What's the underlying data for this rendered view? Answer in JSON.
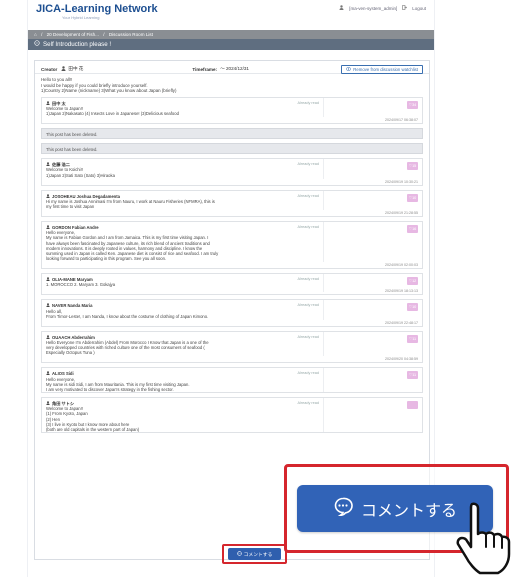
{
  "header": {
    "logo": "JICA-Learning Network",
    "logo_sub": "Your Hybrid Learning",
    "user": "[ma-ven-system_admin]",
    "logout": "Logout"
  },
  "breadcrumb": {
    "home": "⌂",
    "course": "20 Development of Fish...",
    "page": "Discussion Room List"
  },
  "title": "Self Introduction please !",
  "creator": {
    "label": "Creator",
    "name": "田中 花",
    "timeframe_label": "Timeframe:",
    "timeframe_value": "～ 2024/12/31",
    "remove_button": "Remove from discussion watchlist"
  },
  "intro": [
    "Hello to you all!!",
    "I would be happy if you could briefly introduce yourself.",
    "1)Country  2)Name (nickname)  3)What you know about Japan (briefly)"
  ],
  "posts": [
    {
      "author": "田中 太",
      "status": "Already read",
      "like": "♡34",
      "body": [
        "Welcome to Japan!!",
        "1)Japan   2)Nakasato  (4) Insects Love in Japanese! (3)Delicious seafood"
      ],
      "time": "2024/09/17 06:38:07"
    },
    {
      "deleted": "This post has been deleted."
    },
    {
      "deleted": "This post has been deleted."
    },
    {
      "author": "佐藤 浩二",
      "status": "Already read",
      "like": "♡15",
      "body": [
        "Welcome to Koichi!!",
        "1)Japan 2)Sati Sato (Sato) 3)Hiraoka"
      ],
      "time": "2024/09/19 10:30:21"
    },
    {
      "author": "JOSOHEAU Joshua Degadamenta",
      "status": "Already read",
      "like": "♡10",
      "body": [
        "Hi my name is Joshua Annimasi I'm from Nauru, I work at Nauru Fisheries (NFMRA), this is",
        "my first time to visit Japan"
      ],
      "time": "2024/09/19 21:28:55"
    },
    {
      "author": "GORDON Fabian Andre",
      "status": "Already read",
      "like": "♡16",
      "body": [
        "Hello everyone,",
        "My name is Fabian Gordon and I am from Jamaica. This is my first time visiting Japan. I",
        "have always been fascinated by Japanese culture, its rich blend of ancient traditions and",
        "modern innovations. It is deeply rooted in values, harmony and discipline. I know the",
        "summing used in Japan is called Ken. Japanese diet is consist of rice and seafood. I am truly",
        "looking forward to participating in this program. See you all soon."
      ],
      "time": "2024/09/19 02:00:03"
    },
    {
      "author": "OLIA-MANE Maryam",
      "status": "Already read",
      "like": "♡12",
      "body": [
        "1. MOROCCO 2. Maryam 3. Gokajya"
      ],
      "time": "2024/09/19 18:13:13"
    },
    {
      "author": "NAVER Nanda Maria",
      "status": "Already read",
      "like": "♡10",
      "body": [
        "Hello all,",
        "From Timor-Leste!, I am Nanda, I know about the costume of clothing of Japan Kimono."
      ],
      "time": "2024/09/19 22:48:17"
    },
    {
      "author": "OUAACH Abderrahim",
      "status": "Already read",
      "like": "♡11",
      "body": [
        "Hello Everyone I'm Abderrahim (Abdel) From Morocco I Know that Japan is a one of the",
        "very developped countries with riched culture one of the most consumers of seafood (",
        "Especially Octopus Tuna )"
      ],
      "time": "2024/09/20 04:38:59"
    },
    {
      "author": "ALIOS Sidi",
      "status": "Already read",
      "like": "♡11",
      "body": [
        "Hello everyone,",
        "My name is sidi Sidi, I am from Mauritania. This is my first time visiting Japan.",
        "I am very motivated to discover Japan's strategy in the fishing sector."
      ],
      "time": ""
    },
    {
      "author": "角田 サトシ",
      "status": "Already read",
      "like": "",
      "body": [
        "Welcome to Japan!!",
        "(1) From Kyoto, Japan",
        "(2) Hen",
        "(3) I live in Kyoto but I know more about here",
        "(both are old capitals in the western part of Japan)"
      ],
      "time": ""
    }
  ],
  "comment_button": "コメントする",
  "comment_button_large": "コメントする",
  "colors": {
    "brand": "#1d4f91",
    "accent": "#3163b7",
    "highlight": "#d5262d",
    "like": "#e7b8e3"
  }
}
